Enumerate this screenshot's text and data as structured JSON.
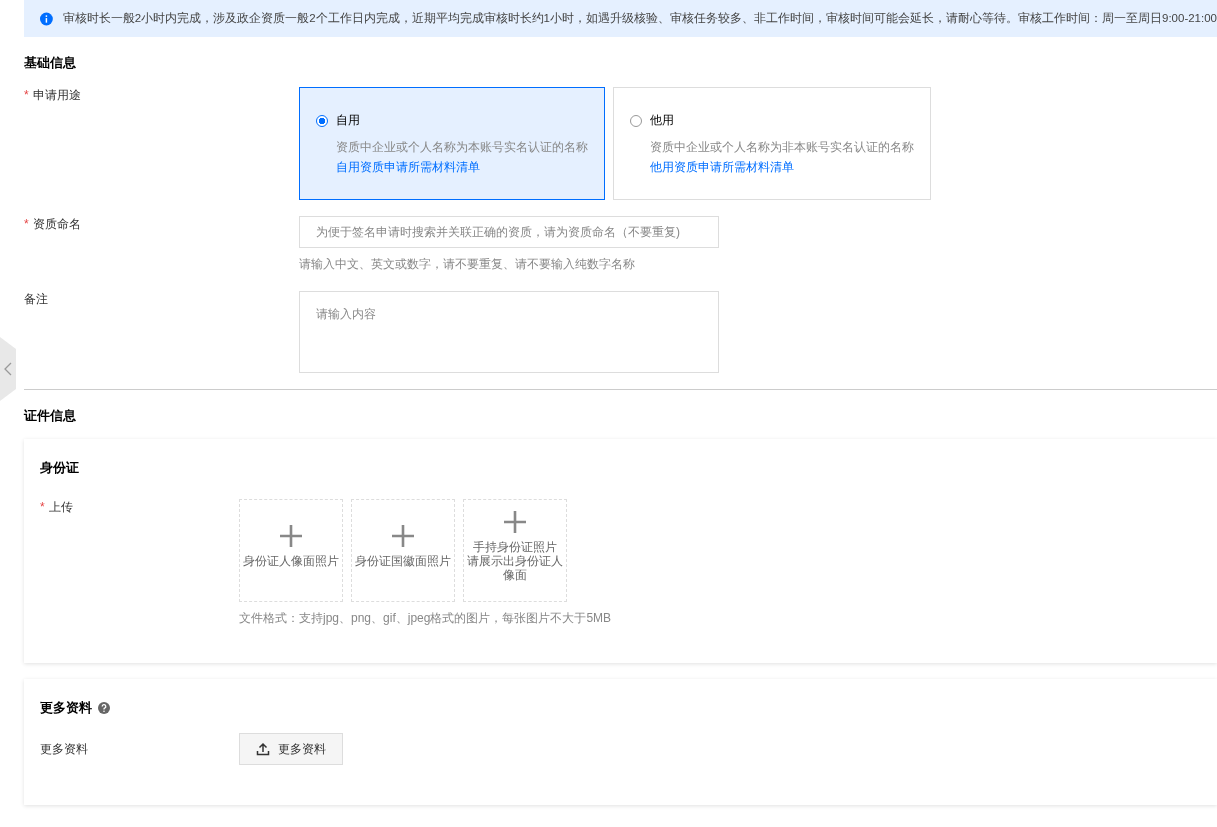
{
  "notice": {
    "text": "审核时长一般2小时内完成，涉及政企资质一般2个工作日内完成，近期平均完成审核时长约1小时，如遇升级核验、审核任务较多、非工作时间，审核时间可能会延长，请耐心等待。审核工作时间：周一至周日9:00-21:00"
  },
  "basic": {
    "title": "基础信息",
    "usage": {
      "label": "申请用途",
      "required_mark": "*",
      "options": [
        {
          "title": "自用",
          "desc": "资质中企业或个人名称为本账号实名认证的名称",
          "link": "自用资质申请所需材料清单",
          "selected": true
        },
        {
          "title": "他用",
          "desc": "资质中企业或个人名称为非本账号实名认证的名称",
          "link": "他用资质申请所需材料清单",
          "selected": false
        }
      ]
    },
    "name": {
      "label": "资质命名",
      "required_mark": "*",
      "placeholder": "为便于签名申请时搜索并关联正确的资质，请为资质命名（不要重复)",
      "hint": "请输入中文、英文或数字，请不要重复、请不要输入纯数字名称"
    },
    "remark": {
      "label": "备注",
      "placeholder": "请输入内容"
    }
  },
  "cert": {
    "title": "证件信息",
    "id_card": {
      "title": "身份证",
      "upload": {
        "label": "上传",
        "required_mark": "*",
        "slots": [
          {
            "lines": [
              "身份证人像面照片"
            ]
          },
          {
            "lines": [
              "身份证国徽面照片"
            ]
          },
          {
            "lines": [
              "手持身份证照片",
              "请展示出身份证人",
              "像面"
            ]
          }
        ],
        "hint": "文件格式：支持jpg、png、gif、jpeg格式的图片，每张图片不大于5MB"
      }
    },
    "more": {
      "title": "更多资料",
      "label": "更多资料",
      "button": "更多资料"
    }
  }
}
